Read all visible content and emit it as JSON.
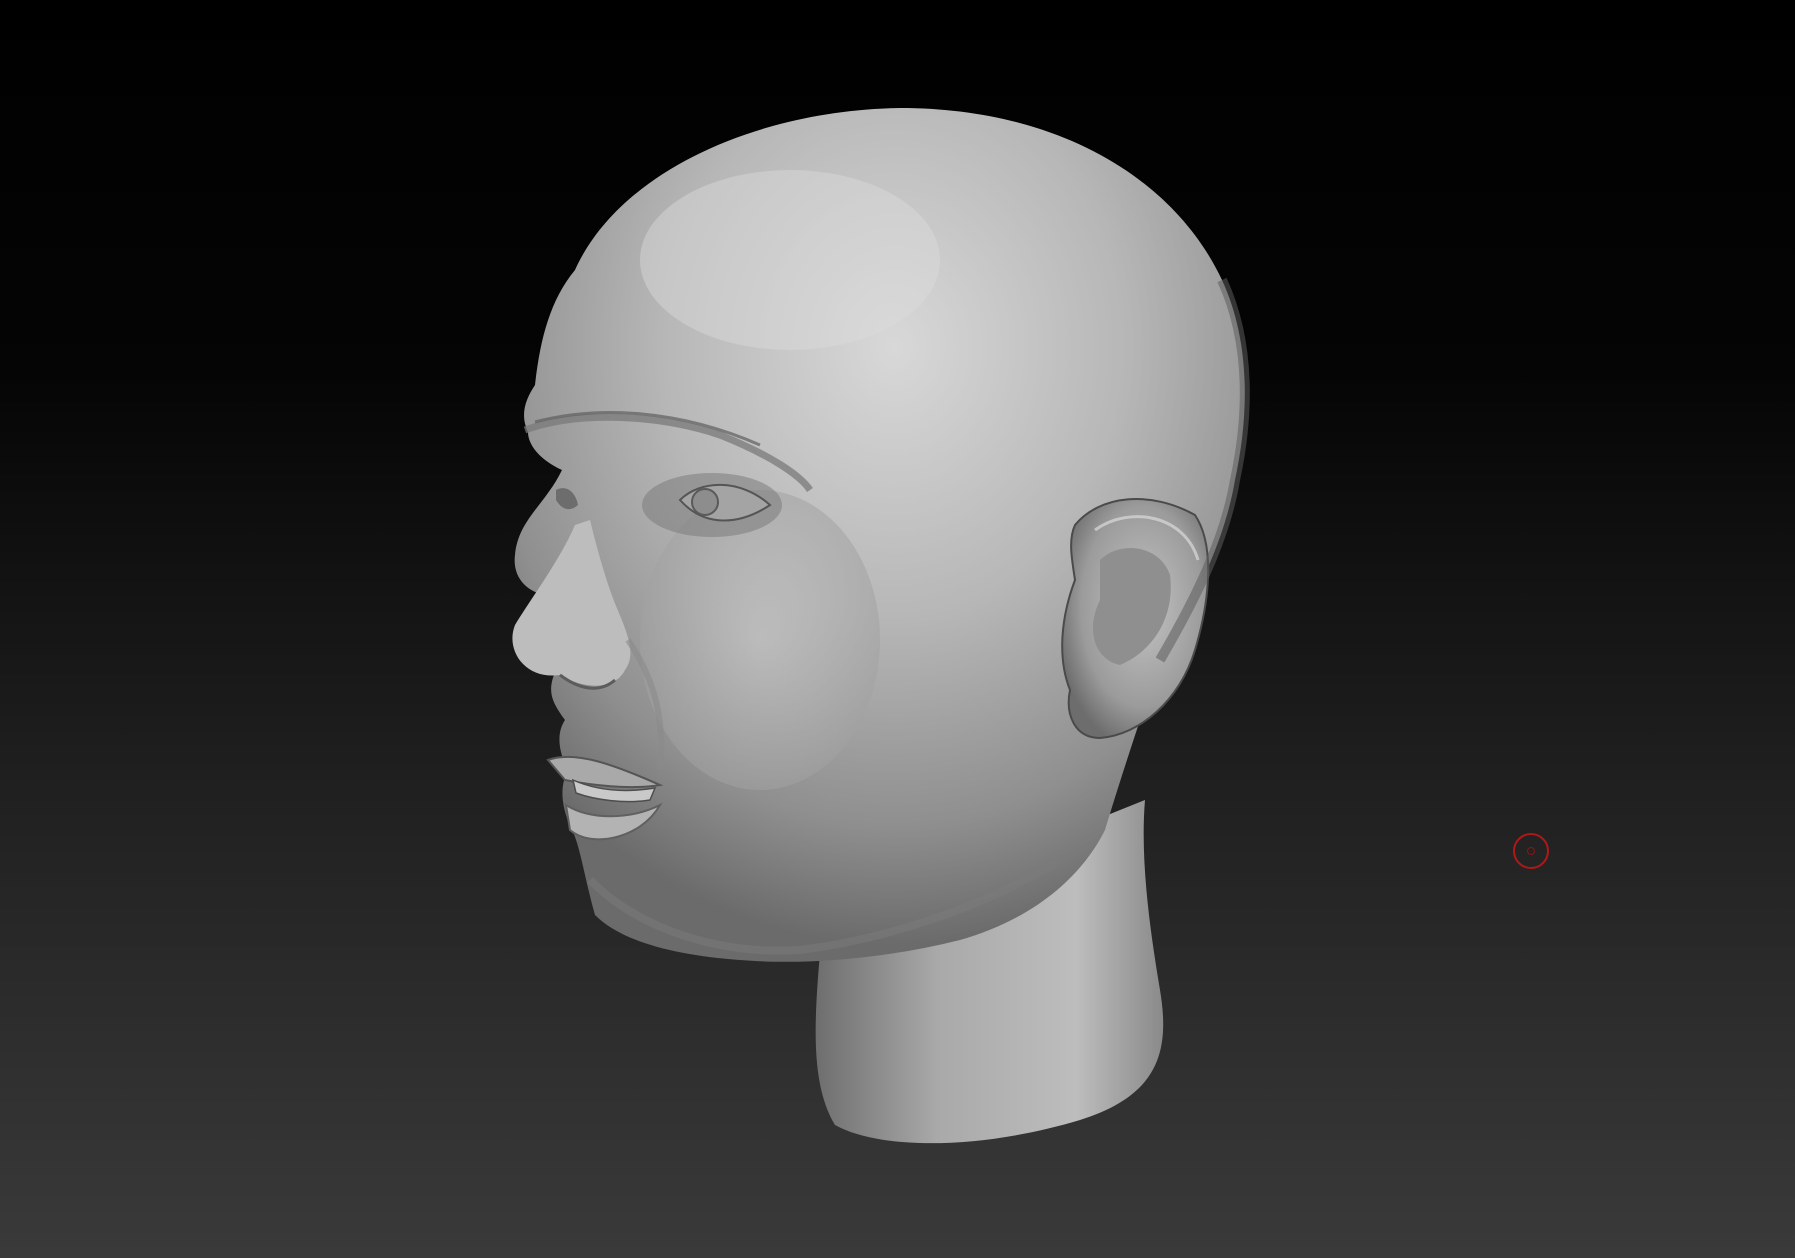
{
  "canvas": {
    "background_top": "#000000",
    "background_bottom": "#3a3a3a",
    "model": "sculpted-head",
    "material_color": "#b4b4b4"
  },
  "brush_cursor": {
    "icon": "brush-circle-icon",
    "color": "#b01818"
  }
}
